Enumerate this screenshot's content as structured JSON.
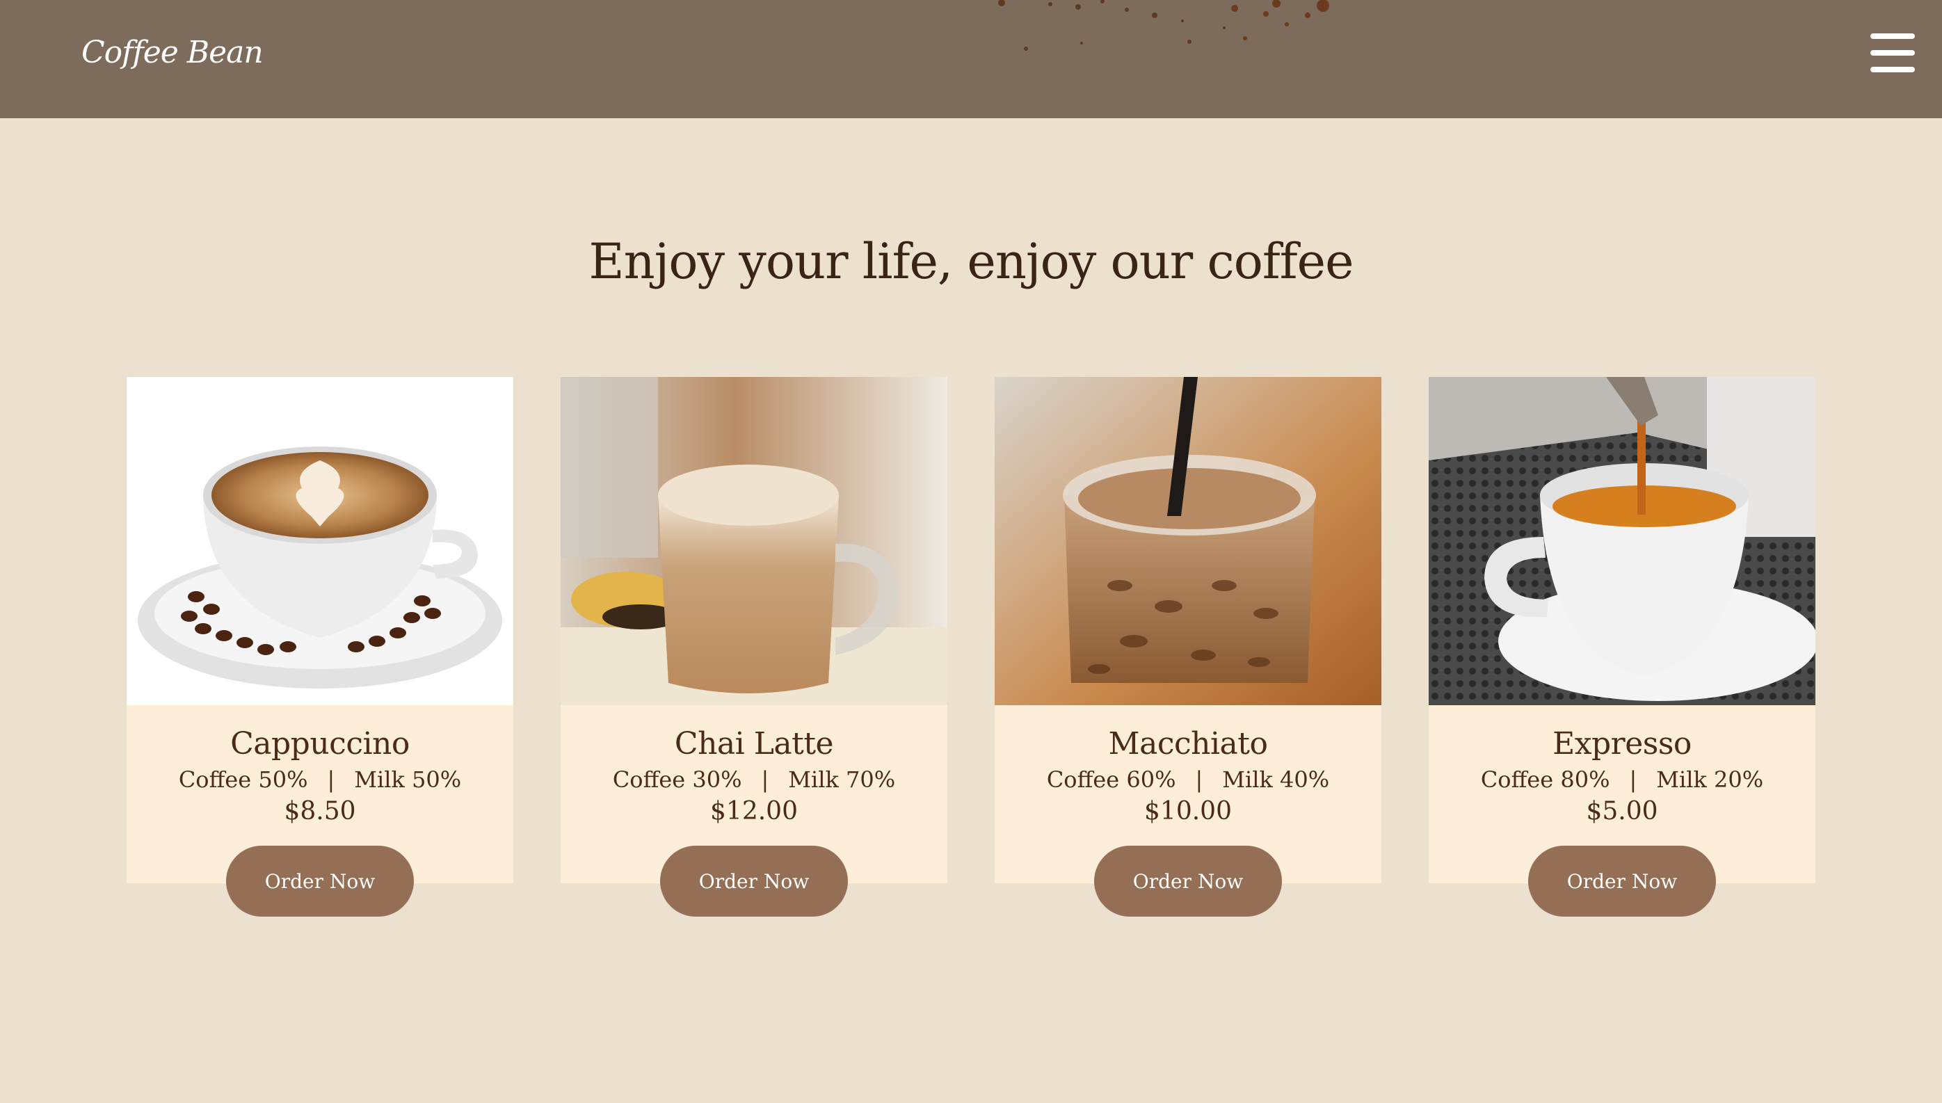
{
  "header": {
    "logo": "Coffee Bean",
    "menu_icon": "hamburger-icon",
    "background": "#7d6b5b"
  },
  "main": {
    "headline": "Enjoy your life, enjoy our coffee"
  },
  "products": [
    {
      "name": "Cappuccino",
      "coffee": "Coffee 50%",
      "milk": "Milk 50%",
      "separator": "|",
      "price": "$8.50",
      "button": "Order Now",
      "image": "cappuccino-photo"
    },
    {
      "name": "Chai Latte",
      "coffee": "Coffee 30%",
      "milk": "Milk 70%",
      "separator": "|",
      "price": "$12.00",
      "button": "Order Now",
      "image": "chai-latte-photo"
    },
    {
      "name": "Macchiato",
      "coffee": "Coffee 60%",
      "milk": "Milk 40%",
      "separator": "|",
      "price": "$10.00",
      "button": "Order Now",
      "image": "iced-macchiato-photo"
    },
    {
      "name": "Expresso",
      "coffee": "Coffee 80%",
      "milk": "Milk 20%",
      "separator": "|",
      "price": "$5.00",
      "button": "Order Now",
      "image": "espresso-photo"
    }
  ],
  "colors": {
    "page_background": "#ece0cf",
    "card_background": "#fdeeda",
    "button": "#946f55",
    "text": "#4a2c16"
  }
}
